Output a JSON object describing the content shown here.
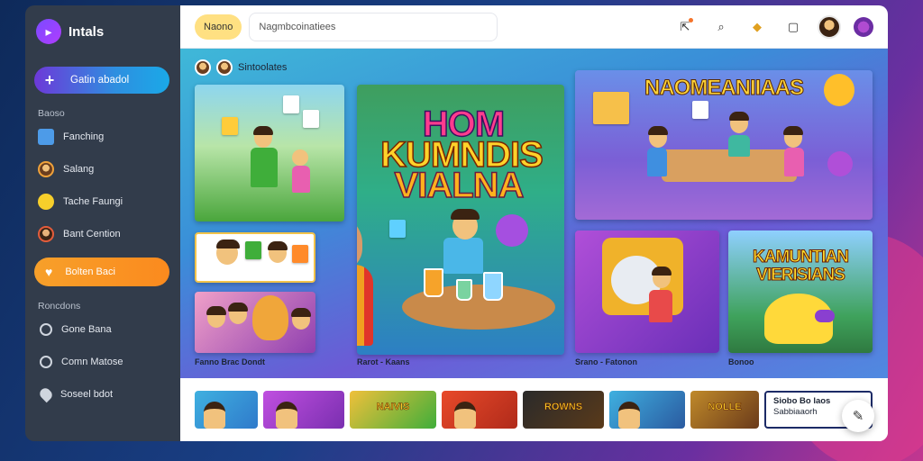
{
  "app": {
    "name": "Intals"
  },
  "sidebar": {
    "create_label": "Gatin abadol",
    "section1": "Baoso",
    "items": [
      {
        "label": "Fanching",
        "icon": "book-icon"
      },
      {
        "label": "Salang",
        "icon": "avatar-icon"
      },
      {
        "label": "Tache Faungi",
        "icon": "smiley-icon"
      },
      {
        "label": "Bant Cention",
        "icon": "avatar-icon"
      }
    ],
    "active_label": "Bolten Baci",
    "section2": "Roncdons",
    "items2": [
      {
        "label": "Gone Bana",
        "icon": "circle-outline-icon"
      },
      {
        "label": "Comn Matose",
        "icon": "circle-outline-icon"
      },
      {
        "label": "Soseel bdot",
        "icon": "pin-icon"
      }
    ]
  },
  "topbar": {
    "chip_label": "Naono",
    "search_value": "Nagmbcoinatiees"
  },
  "breadcrumb": {
    "label": "Sintoolates"
  },
  "cards": {
    "hero_line1": "HOM",
    "hero_line2": "KUMNDIS",
    "hero_line3": "VIALNA",
    "featured_title": "NAOMEANIIAAS",
    "tile_title_line1": "KAMUNTIAN",
    "tile_title_line2": "VIERISIANS"
  },
  "captions": {
    "c1": "Fanno Brac Dondt",
    "c2": "Rarot - Kaans",
    "c3": "Srano - Fatonon",
    "c4": "Bonoo"
  },
  "strip": {
    "thumb3_text": "NAIVIS",
    "thumb6_text": "ROWNS",
    "thumb8_text": "NOLLE",
    "last_line1": "Siobo Bo laos",
    "last_line2": "Sabbiaaorh"
  },
  "colors": {
    "sidebar_bg": "#323c4b",
    "active_orange": "#fb8a1e",
    "create_gradient_start": "#6d39d8",
    "create_gradient_end": "#1aa9e8"
  }
}
